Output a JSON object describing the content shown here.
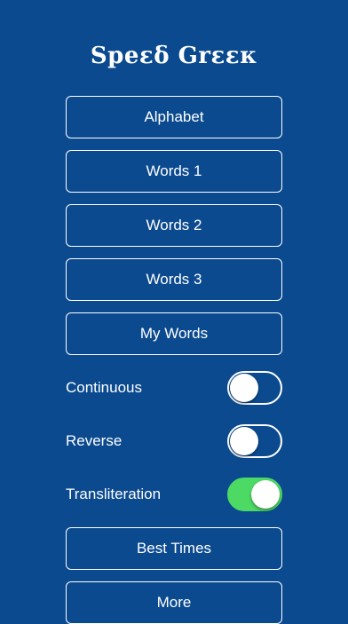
{
  "app": {
    "title": "Speεδ Grεεκ"
  },
  "menu": {
    "alphabet": "Alphabet",
    "words1": "Words 1",
    "words2": "Words 2",
    "words3": "Words 3",
    "my_words": "My Words",
    "best_times": "Best Times",
    "more": "More"
  },
  "settings": {
    "continuous": {
      "label": "Continuous",
      "on": false
    },
    "reverse": {
      "label": "Reverse",
      "on": false
    },
    "transliteration": {
      "label": "Transliteration",
      "on": true
    }
  },
  "colors": {
    "background": "#0b4a8f",
    "toggle_on": "#4cd964",
    "foreground": "#ffffff"
  }
}
